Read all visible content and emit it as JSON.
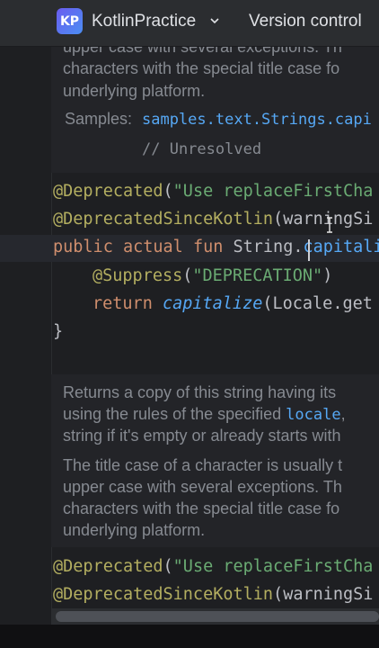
{
  "titlebar": {
    "project_badge": "KP",
    "project_name": "KotlinPractice",
    "version_control": "Version control"
  },
  "doc1": {
    "line1": "upper case with several exceptions. Th",
    "line2": "characters with the special title case fo",
    "line3": "underlying platform.",
    "samples_label": "Samples:",
    "samples_link": "samples.text.Strings.capi",
    "unresolved": "// Unresolved"
  },
  "code1": {
    "deprecated_ann": "@Deprecated",
    "deprecated_arg": "\"Use replaceFirstCha",
    "since_ann": "@DeprecatedSinceKotlin",
    "since_arg": "warningSi",
    "kw_public": "public",
    "kw_actual": "actual",
    "kw_fun": "fun",
    "receiver": "String.",
    "fn_name": "capitaliz",
    "suppress_ann": "@Suppress",
    "suppress_arg": "\"DEPRECATION\"",
    "kw_return": "return",
    "call_name": "capitalize",
    "call_args": "(Locale.get",
    "closing_brace": "}"
  },
  "doc2": {
    "p1_line1": "Returns a copy of this string having its",
    "p1_line2_pre": "using the rules of the specified ",
    "p1_line2_code": "locale",
    "p1_line2_post": ",",
    "p1_line3": "string if it's empty or already starts with",
    "p2_line1": "The title case of a character is usually t",
    "p2_line2": "upper case with several exceptions. Th",
    "p2_line3": "characters with the special title case fo",
    "p2_line4": "underlying platform."
  },
  "code2": {
    "deprecated_ann": "@Deprecated",
    "deprecated_arg": "\"Use replaceFirstCha",
    "since_ann": "@DeprecatedSinceKotlin",
    "since_arg": "warningSi"
  }
}
